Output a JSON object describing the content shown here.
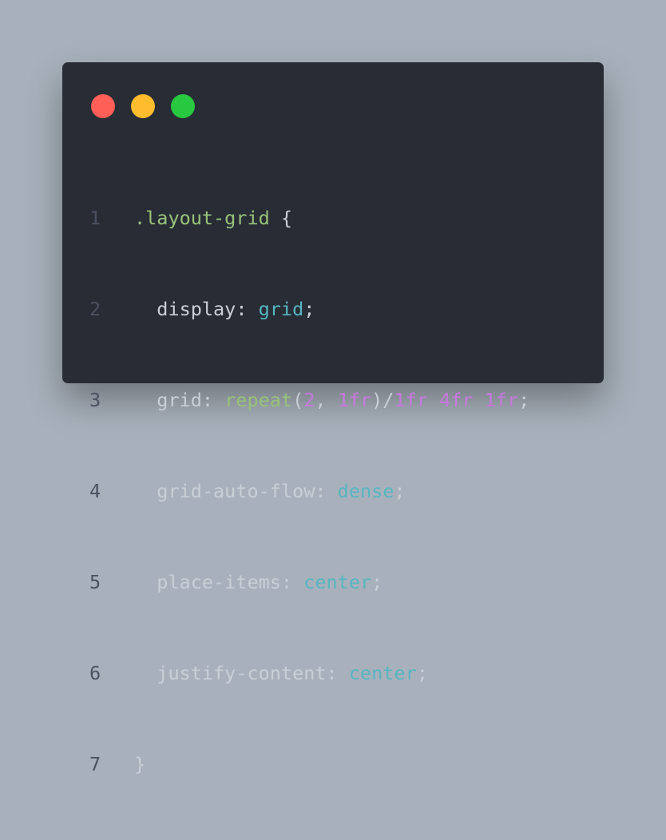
{
  "window": {
    "dots": [
      "close",
      "minimize",
      "maximize"
    ]
  },
  "code": {
    "line_numbers": [
      "1",
      "2",
      "3",
      "4",
      "5",
      "6",
      "7"
    ],
    "line1": {
      "selector": ".layout-grid",
      "brace": " {"
    },
    "line2": {
      "prop": "  display: ",
      "value": "grid",
      "end": ";"
    },
    "line3": {
      "prop": "  grid: ",
      "fn": "repeat",
      "open": "(",
      "n1": "2",
      "comma": ", ",
      "n2": "1fr",
      "close": ")/",
      "n3": "1fr",
      "sp1": " ",
      "n4": "4fr",
      "sp2": " ",
      "n5": "1fr",
      "end": ";"
    },
    "line4": {
      "prop": "  grid-auto-flow: ",
      "value": "dense",
      "end": ";"
    },
    "line5": {
      "prop": "  place-items: ",
      "value": "center",
      "end": ";"
    },
    "line6": {
      "prop": "  justify-content: ",
      "value": "center",
      "end": ";"
    },
    "line7": {
      "brace": "}"
    }
  },
  "colors": {
    "background": "#a8b1bb",
    "window": "#282c35",
    "close": "#ff5f57",
    "minimize": "#ffbd2e",
    "maximize": "#28c840",
    "selector": "#98c379",
    "value": "#56b6c2",
    "number": "#c678dd",
    "text": "#c9cfd6",
    "line_number": "#4a5160"
  }
}
